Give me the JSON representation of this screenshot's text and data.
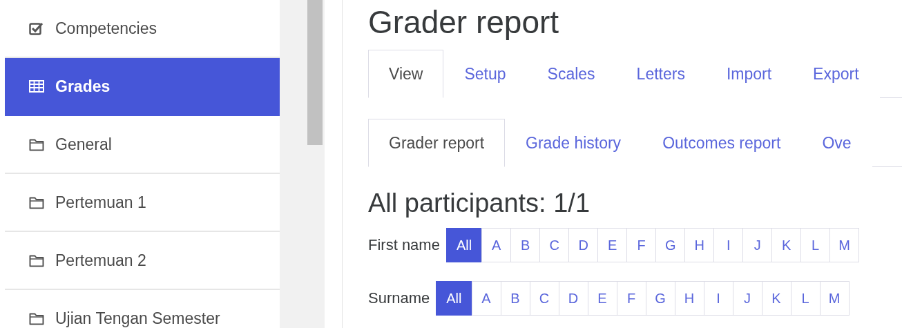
{
  "sidebar": {
    "items": [
      {
        "label": "Competencies",
        "kind": "checkbox",
        "selected": false
      },
      {
        "label": "Grades",
        "kind": "table",
        "selected": true
      },
      {
        "label": "General",
        "kind": "folder",
        "selected": false
      },
      {
        "label": "Pertemuan 1",
        "kind": "folder",
        "selected": false
      },
      {
        "label": "Pertemuan 2",
        "kind": "folder",
        "selected": false
      },
      {
        "label": "Ujian Tengan Semester",
        "kind": "folder",
        "selected": false
      }
    ]
  },
  "title": "Grader report",
  "tabs": [
    {
      "label": "View",
      "selected": true
    },
    {
      "label": "Setup",
      "selected": false
    },
    {
      "label": "Scales",
      "selected": false
    },
    {
      "label": "Letters",
      "selected": false
    },
    {
      "label": "Import",
      "selected": false
    },
    {
      "label": "Export",
      "selected": false
    }
  ],
  "subtabs": [
    {
      "label": "Grader report",
      "selected": true
    },
    {
      "label": "Grade history",
      "selected": false
    },
    {
      "label": "Outcomes report",
      "selected": false
    },
    {
      "label": "Ove",
      "selected": false
    }
  ],
  "heading": "All participants: 1/1",
  "filters": [
    {
      "label": "First name",
      "letters": [
        {
          "label": "All",
          "selected": true
        },
        {
          "label": "A",
          "selected": false
        },
        {
          "label": "B",
          "selected": false
        },
        {
          "label": "C",
          "selected": false
        },
        {
          "label": "D",
          "selected": false
        },
        {
          "label": "E",
          "selected": false
        },
        {
          "label": "F",
          "selected": false
        },
        {
          "label": "G",
          "selected": false
        },
        {
          "label": "H",
          "selected": false
        },
        {
          "label": "I",
          "selected": false
        },
        {
          "label": "J",
          "selected": false
        },
        {
          "label": "K",
          "selected": false
        },
        {
          "label": "L",
          "selected": false
        },
        {
          "label": "M",
          "selected": false
        }
      ]
    },
    {
      "label": "Surname",
      "letters": [
        {
          "label": "All",
          "selected": true
        },
        {
          "label": "A",
          "selected": false
        },
        {
          "label": "B",
          "selected": false
        },
        {
          "label": "C",
          "selected": false
        },
        {
          "label": "D",
          "selected": false
        },
        {
          "label": "E",
          "selected": false
        },
        {
          "label": "F",
          "selected": false
        },
        {
          "label": "G",
          "selected": false
        },
        {
          "label": "H",
          "selected": false
        },
        {
          "label": "I",
          "selected": false
        },
        {
          "label": "J",
          "selected": false
        },
        {
          "label": "K",
          "selected": false
        },
        {
          "label": "L",
          "selected": false
        },
        {
          "label": "M",
          "selected": false
        }
      ]
    }
  ]
}
